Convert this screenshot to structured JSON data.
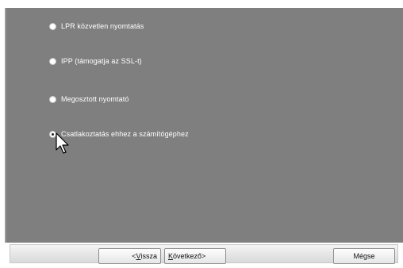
{
  "options": [
    {
      "label": "LPR közvetlen nyomtatás",
      "checked": false
    },
    {
      "label": "IPP (támogatja az SSL-t)",
      "checked": false
    },
    {
      "label": "Megosztott nyomtató",
      "checked": false
    },
    {
      "label": "Csatlakoztatás ehhez a számítógéphez",
      "checked": true
    }
  ],
  "buttons": {
    "back": {
      "prefix": "< ",
      "accel": "V",
      "rest": "issza"
    },
    "next": {
      "accel": "K",
      "rest": "övetkező",
      "suffix": " >"
    },
    "cancel": "Mégse"
  },
  "icons": {
    "cursor": "mouse-pointer-icon"
  }
}
